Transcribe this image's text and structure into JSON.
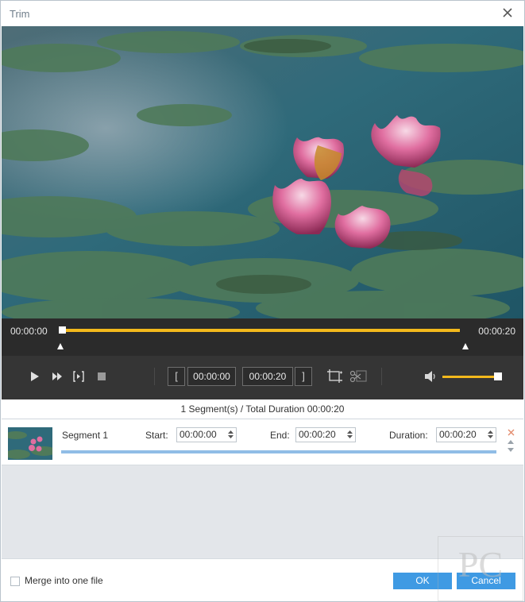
{
  "window": {
    "title": "Trim"
  },
  "timeline": {
    "start_time": "00:00:00",
    "end_time": "00:00:20",
    "progress_fraction": 0.0
  },
  "controls": {
    "clip_start": "00:00:00",
    "clip_end": "00:00:20",
    "start_bracket": "[",
    "end_bracket": "]",
    "volume_fraction": 0.9,
    "accent_color": "#f3b91c"
  },
  "summary": "1 Segment(s) / Total Duration 00:00:20",
  "segment": {
    "name": "Segment 1",
    "start_label": "Start:",
    "start_value": "00:00:00",
    "end_label": "End:",
    "end_value": "00:00:20",
    "duration_label": "Duration:",
    "duration_value": "00:00:20"
  },
  "footer": {
    "merge_label": "Merge into one file",
    "ok_label": "OK",
    "cancel_label": "Cancel",
    "button_color": "#3f9ae3"
  },
  "watermark": "PC",
  "icons": [
    "close-icon",
    "play-icon",
    "fast-forward-icon",
    "frame-step-icon",
    "stop-icon",
    "crop-icon",
    "scissors-icon",
    "volume-icon"
  ]
}
